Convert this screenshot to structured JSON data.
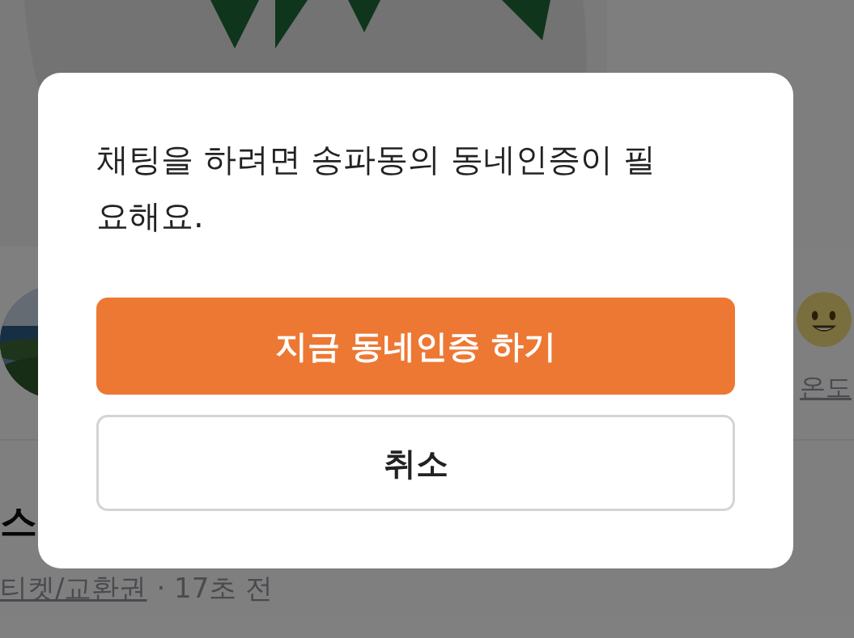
{
  "seller": {
    "temperature_label": "온도"
  },
  "post": {
    "title": "스",
    "category": "티켓/교환권",
    "time": "· 17초 전"
  },
  "dialog": {
    "message": "채팅을 하려면 송파동의 동네인증이 필요해요.",
    "buttons": [
      {
        "label": "지금 동네인증 하기",
        "kind": "primary"
      },
      {
        "label": "취소",
        "kind": "secondary"
      }
    ]
  }
}
